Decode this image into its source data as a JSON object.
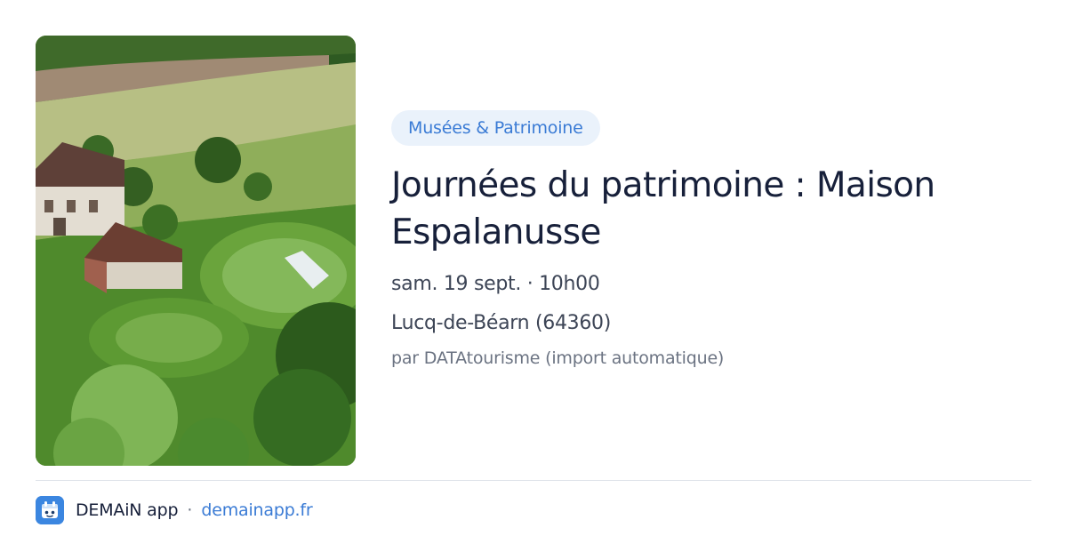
{
  "photo": {
    "description_icon": "landscape-photo"
  },
  "event": {
    "category": "Musées & Patrimoine",
    "title": "Journées du patrimoine : Maison Espalanusse",
    "datetime": "sam. 19 sept. · 10h00",
    "location": "Lucq-de-Béarn (64360)",
    "source": "par DATAtourisme (import automatique)"
  },
  "footer": {
    "app_name": "DEMAiN app",
    "separator": "·",
    "link": "demainapp.fr"
  },
  "colors": {
    "accent": "#3a7bd5",
    "chip_bg": "#eaf2fb",
    "title": "#17203a",
    "muted": "#6b7382"
  }
}
